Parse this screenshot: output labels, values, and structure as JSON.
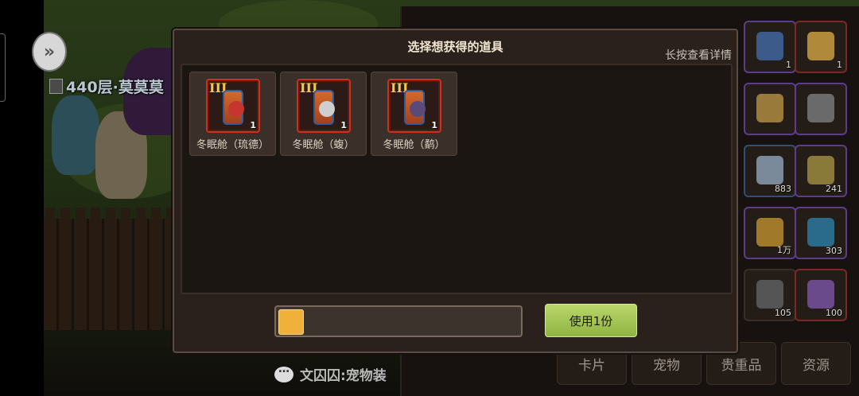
{
  "background": {
    "floor_label": "440层·莫莫莫",
    "chat_text": "文囚囚:宠物装",
    "bottom_tabs": [
      "卡片",
      "宠物",
      "贵重品",
      "资源"
    ],
    "inventory_counts": [
      "1",
      "1",
      "883",
      "241",
      "1万",
      "303",
      "105",
      "100"
    ]
  },
  "dialog": {
    "title": "选择想获得的道具",
    "hint": "长按查看详情",
    "items": [
      {
        "tier": "III",
        "qty": "1",
        "name": "冬眠舱（琉德）",
        "face_color": "#c7352e"
      },
      {
        "tier": "III",
        "qty": "1",
        "name": "冬眠舱（蝮）",
        "face_color": "#cfcfcf"
      },
      {
        "tier": "III",
        "qty": "1",
        "name": "冬眠舱（鹬）",
        "face_color": "#5a4a7a"
      }
    ],
    "progress": 0.1,
    "use_button": "使用1份"
  },
  "colors": {
    "accent_green": "#a4c655",
    "progress_yellow": "#f0b03a",
    "item_border": "#c9331d"
  }
}
